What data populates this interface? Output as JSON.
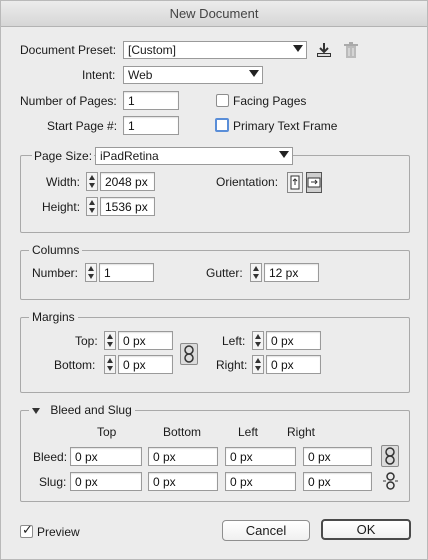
{
  "window": {
    "title": "New Document"
  },
  "document_preset": {
    "label": "Document Preset:",
    "value": "[Custom]"
  },
  "intent": {
    "label": "Intent:",
    "value": "Web"
  },
  "number_of_pages": {
    "label": "Number of Pages:",
    "value": "1"
  },
  "start_page": {
    "label": "Start Page #:",
    "value": "1"
  },
  "facing_pages": {
    "label": "Facing Pages",
    "checked": false
  },
  "primary_text_frame": {
    "label": "Primary Text Frame",
    "checked": false
  },
  "page_size": {
    "label": "Page Size:",
    "value": "iPadRetina",
    "width_label": "Width:",
    "width": "2048 px",
    "height_label": "Height:",
    "height": "1536 px",
    "orientation_label": "Orientation:",
    "orientation": "landscape"
  },
  "columns": {
    "title": "Columns",
    "number_label": "Number:",
    "number": "1",
    "gutter_label": "Gutter:",
    "gutter": "12 px"
  },
  "margins": {
    "title": "Margins",
    "top_label": "Top:",
    "top": "0 px",
    "bottom_label": "Bottom:",
    "bottom": "0 px",
    "left_label": "Left:",
    "left": "0 px",
    "right_label": "Right:",
    "right": "0 px"
  },
  "bleed_slug": {
    "title": "Bleed and Slug",
    "headers": [
      "Top",
      "Bottom",
      "Left",
      "Right"
    ],
    "bleed_label": "Bleed:",
    "bleed": [
      "0 px",
      "0 px",
      "0 px",
      "0 px"
    ],
    "slug_label": "Slug:",
    "slug": [
      "0 px",
      "0 px",
      "0 px",
      "0 px"
    ]
  },
  "preview": {
    "label": "Preview",
    "checked": true
  },
  "buttons": {
    "cancel": "Cancel",
    "ok": "OK"
  }
}
